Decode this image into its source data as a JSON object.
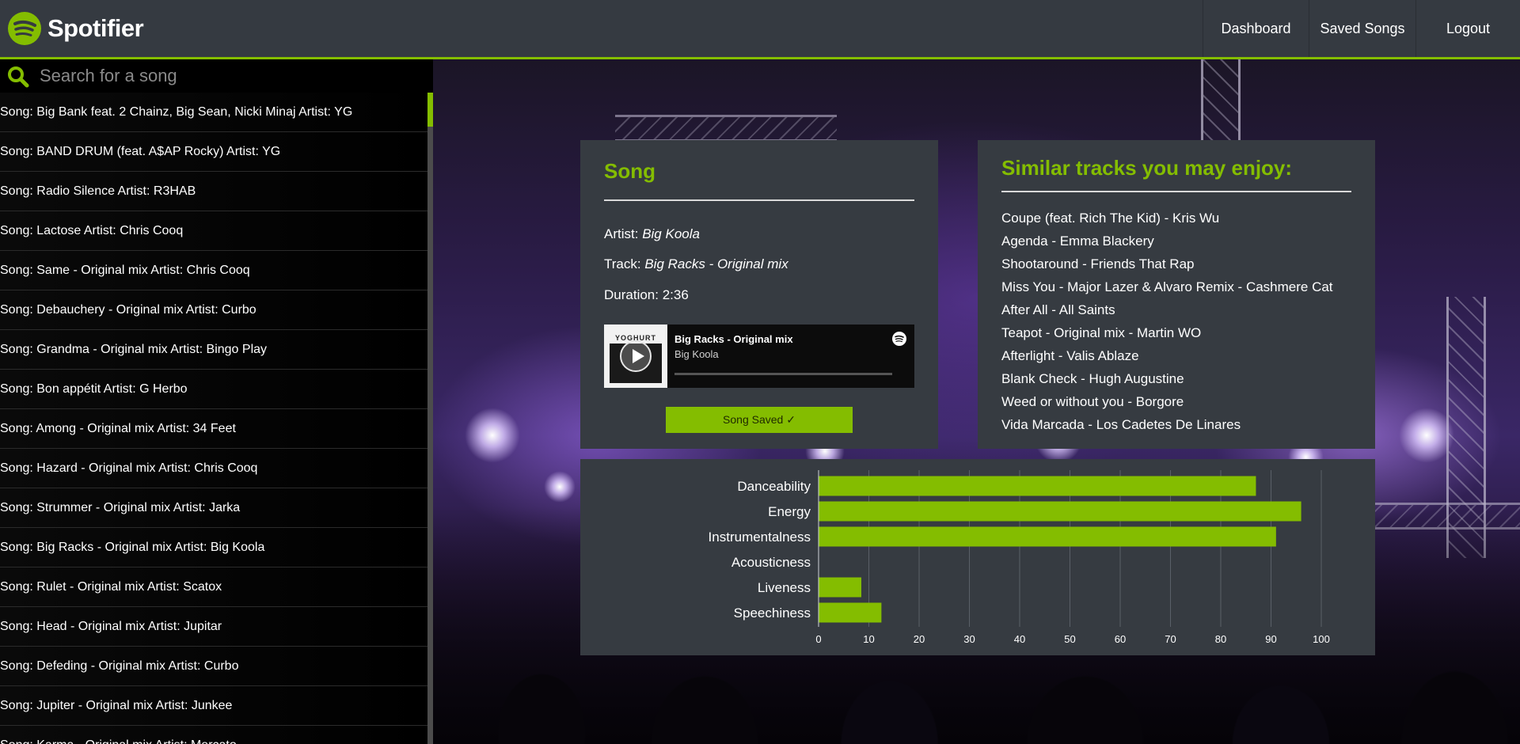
{
  "app": {
    "name": "Spotifier"
  },
  "nav": {
    "dashboard": "Dashboard",
    "saved_songs": "Saved Songs",
    "logout": "Logout"
  },
  "search": {
    "placeholder": "Search for a song",
    "value": ""
  },
  "song_list": [
    "Song: Big Bank feat. 2 Chainz, Big Sean, Nicki Minaj Artist: YG",
    "Song: BAND DRUM (feat. A$AP Rocky) Artist: YG",
    "Song: Radio Silence Artist: R3HAB",
    "Song: Lactose Artist: Chris Cooq",
    "Song: Same - Original mix Artist: Chris Cooq",
    "Song: Debauchery - Original mix Artist: Curbo",
    "Song: Grandma - Original mix Artist: Bingo Play",
    "Song: Bon appétit Artist: G Herbo",
    "Song: Among - Original mix Artist: 34 Feet",
    "Song: Hazard - Original mix Artist: Chris Cooq",
    "Song: Strummer - Original mix Artist: Jarka",
    "Song: Big Racks - Original mix Artist: Big Koola",
    "Song: Rulet - Original mix Artist: Scatox",
    "Song: Head - Original mix Artist: Jupitar",
    "Song: Defeding - Original mix Artist: Curbo",
    "Song: Jupiter - Original mix Artist: Junkee",
    "Song: Karma - Original mix Artist: Mercato"
  ],
  "song_card": {
    "title": "Song",
    "artist_label": "Artist:",
    "artist": "Big Koola",
    "track_label": "Track:",
    "track": "Big Racks - Original mix",
    "duration_label": "Duration:",
    "duration": "2:36",
    "player": {
      "album_text": "YOGHURT",
      "track": "Big Racks - Original mix",
      "artist": "Big Koola"
    },
    "saved_button": "Song Saved ✓"
  },
  "similar": {
    "title": "Similar tracks you may enjoy:",
    "tracks": [
      "Coupe (feat. Rich The Kid) - Kris Wu",
      "Agenda - Emma Blackery",
      "Shootaround - Friends That Rap",
      "Miss You - Major Lazer & Alvaro Remix - Cashmere Cat",
      "After All - All Saints",
      "Teapot - Original mix - Martin WO",
      "Afterlight - Valis Ablaze",
      "Blank Check - Hugh Augustine",
      "Weed or without you - Borgore",
      "Vida Marcada - Los Cadetes De Linares"
    ]
  },
  "colors": {
    "accent": "#84bd00",
    "card": "#363b41",
    "topbar": "#353a41"
  },
  "chart_data": {
    "type": "bar",
    "orientation": "horizontal",
    "categories": [
      "Danceability",
      "Energy",
      "Instrumentalness",
      "Acousticness",
      "Liveness",
      "Speechiness"
    ],
    "values": [
      87,
      96,
      91,
      0,
      8.5,
      12.5
    ],
    "xlim": [
      0,
      100
    ],
    "xticks": [
      0,
      10,
      20,
      30,
      40,
      50,
      60,
      70,
      80,
      90,
      100
    ],
    "grid": true,
    "color": "#84bd00"
  }
}
